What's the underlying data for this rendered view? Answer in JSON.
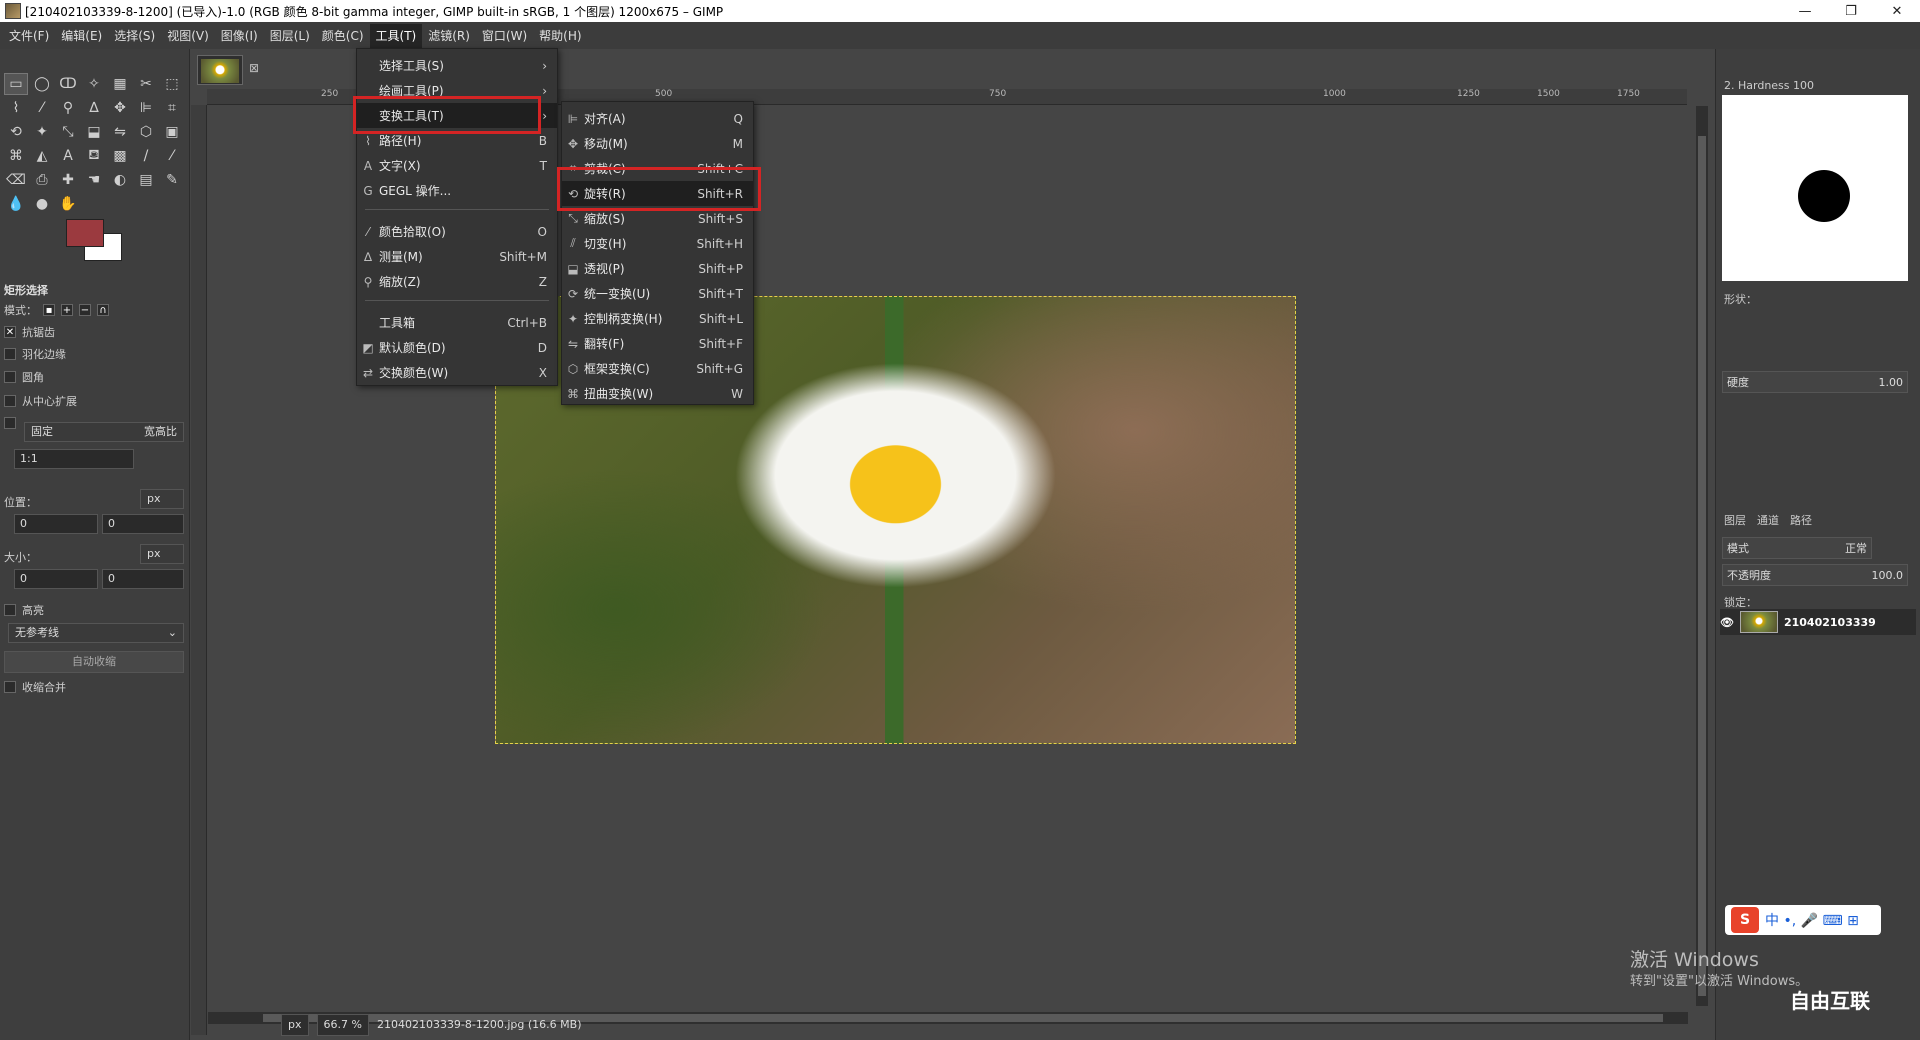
{
  "window": {
    "title": "[210402103339-8-1200] (已导入)-1.0 (RGB 颜色 8-bit gamma integer, GIMP built-in sRGB, 1 个图层) 1200x675 – GIMP",
    "minimize": "—",
    "maximize": "❐",
    "close": "✕"
  },
  "menubar": [
    "文件(F)",
    "编辑(E)",
    "选择(S)",
    "视图(V)",
    "图像(I)",
    "图层(L)",
    "颜色(C)",
    "工具(T)",
    "滤镜(R)",
    "窗口(W)",
    "帮助(H)"
  ],
  "tools_menu": {
    "items": [
      {
        "label": "选择工具(S)",
        "shortcut": "",
        "icon": "",
        "submenu": true
      },
      {
        "label": "绘画工具(P)",
        "shortcut": "",
        "icon": "",
        "submenu": true
      },
      {
        "label": "变换工具(T)",
        "shortcut": "",
        "icon": "",
        "submenu": true,
        "highlighted": true
      },
      {
        "label": "路径(H)",
        "shortcut": "B",
        "icon": "path-icon"
      },
      {
        "label": "文字(X)",
        "shortcut": "T",
        "icon": "text-icon"
      },
      {
        "label": "GEGL 操作...",
        "shortcut": "",
        "icon": "gegl-icon"
      },
      {
        "label": "颜色拾取(O)",
        "shortcut": "O",
        "icon": "color-picker-icon"
      },
      {
        "label": "测量(M)",
        "shortcut": "Shift+M",
        "icon": "measure-icon"
      },
      {
        "label": "缩放(Z)",
        "shortcut": "Z",
        "icon": "zoom-icon"
      },
      {
        "label": "工具箱",
        "shortcut": "Ctrl+B",
        "icon": ""
      },
      {
        "label": "默认颜色(D)",
        "shortcut": "D",
        "icon": "default-colors-icon"
      },
      {
        "label": "交换颜色(W)",
        "shortcut": "X",
        "icon": "swap-colors-icon"
      }
    ]
  },
  "transform_menu": {
    "items": [
      {
        "label": "对齐(A)",
        "shortcut": "Q"
      },
      {
        "label": "移动(M)",
        "shortcut": "M"
      },
      {
        "label": "剪裁(C)",
        "shortcut": "Shift+C"
      },
      {
        "label": "旋转(R)",
        "shortcut": "Shift+R",
        "highlighted": true
      },
      {
        "label": "缩放(S)",
        "shortcut": "Shift+S"
      },
      {
        "label": "切变(H)",
        "shortcut": "Shift+H"
      },
      {
        "label": "透视(P)",
        "shortcut": "Shift+P"
      },
      {
        "label": "统一变换(U)",
        "shortcut": "Shift+T"
      },
      {
        "label": "控制柄变换(H)",
        "shortcut": "Shift+L"
      },
      {
        "label": "翻转(F)",
        "shortcut": "Shift+F"
      },
      {
        "label": "框架变换(C)",
        "shortcut": "Shift+G"
      },
      {
        "label": "扭曲变换(W)",
        "shortcut": "W"
      }
    ]
  },
  "tool_options": {
    "title": "矩形选择",
    "mode_label": "模式：",
    "antialias": "抗锯齿",
    "feather": "羽化边缘",
    "rounded": "圆角",
    "expand_center": "从中心扩展",
    "fixed": "固定",
    "fixed_type": "宽高比",
    "ratio": "1:1",
    "position_label": "位置：",
    "size_label": "大小：",
    "unit": "px",
    "pos_x": "0",
    "pos_y": "0",
    "size_x": "0",
    "size_y": "0",
    "highlight": "高亮",
    "guides": "无参考线",
    "auto_shrink": "自动收缩",
    "shrink_merged": "收缩合并"
  },
  "ruler_marks": [
    "250",
    "500",
    "750",
    "1000",
    "1250",
    "1500",
    "1750"
  ],
  "status": {
    "unit": "px",
    "zoom": "66.7 %",
    "file": "210402103339-8-1200.jpg (16.6 MB)"
  },
  "right_dock": {
    "brush_name": "2. Hardness 100",
    "shape_label": "形状：",
    "hardness_label": "硬度",
    "hardness_value": "1.00",
    "tabs": [
      "图层",
      "通道",
      "路径"
    ],
    "mode_label": "模式",
    "mode_value": "正常",
    "opacity_label": "不透明度",
    "opacity_value": "100.0",
    "lock_label": "锁定：",
    "layer_name": "210402103339"
  },
  "overlay": {
    "activate_windows": "激活 Windows",
    "activate_hint": "转到\"设置\"以激活 Windows。",
    "ime_text": "中 •, 🎤 ⌨ ⊞",
    "brand": "自由互联"
  }
}
